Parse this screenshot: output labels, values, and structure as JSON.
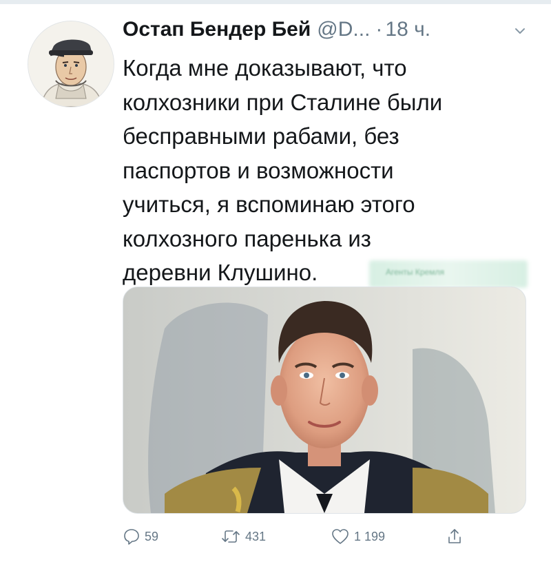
{
  "tweet": {
    "author": {
      "display_name": "Остап Бендер Бей",
      "handle": "@D...",
      "separator": "·",
      "time": "18 ч."
    },
    "text_lines": [
      "Когда мне доказывают, что",
      "колхозники при Сталине были",
      "бесправными рабами, без",
      "паспортов и возможности",
      "учиться, я вспоминаю этого",
      "колхозного паренька из",
      "деревни Клушино."
    ],
    "watermark": "Агенты Кремля",
    "actions": {
      "replies": "59",
      "retweets": "431",
      "likes": "1 199"
    }
  },
  "icons": {
    "reply": "reply-icon",
    "retweet": "retweet-icon",
    "like": "heart-icon",
    "share": "share-icon",
    "menu": "chevron-down-icon"
  },
  "colors": {
    "text": "#14171a",
    "secondary": "#657786",
    "divider": "#e6ecf0"
  }
}
